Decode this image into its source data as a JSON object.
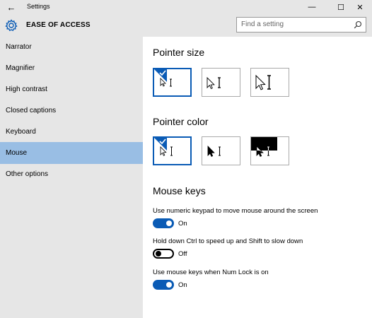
{
  "window": {
    "title": "Settings",
    "minimize_glyph": "—",
    "maximize_glyph": "☐",
    "close_glyph": "✕",
    "back_glyph": "←"
  },
  "header": {
    "title": "EASE OF ACCESS",
    "search_placeholder": "Find a setting"
  },
  "sidebar": {
    "items": [
      {
        "label": "Narrator"
      },
      {
        "label": "Magnifier"
      },
      {
        "label": "High contrast"
      },
      {
        "label": "Closed captions"
      },
      {
        "label": "Keyboard"
      },
      {
        "label": "Mouse"
      },
      {
        "label": "Other options"
      }
    ],
    "active_index": 5
  },
  "main": {
    "pointer_size": {
      "heading": "Pointer size",
      "options": [
        "small",
        "medium",
        "large"
      ],
      "selected": "small"
    },
    "pointer_color": {
      "heading": "Pointer color",
      "options": [
        "white",
        "black",
        "inverted"
      ],
      "selected": "white"
    },
    "mouse_keys": {
      "heading": "Mouse keys",
      "settings": [
        {
          "label": "Use numeric keypad to move mouse around the screen",
          "state": "On"
        },
        {
          "label": "Hold down Ctrl to speed up and Shift to slow down",
          "state": "Off"
        },
        {
          "label": "Use mouse keys when Num Lock is on",
          "state": "On"
        }
      ]
    }
  },
  "colors": {
    "accent": "#0a5bb5",
    "sidebar_bg": "#e6e6e6",
    "active_item_bg": "#99bee4"
  }
}
